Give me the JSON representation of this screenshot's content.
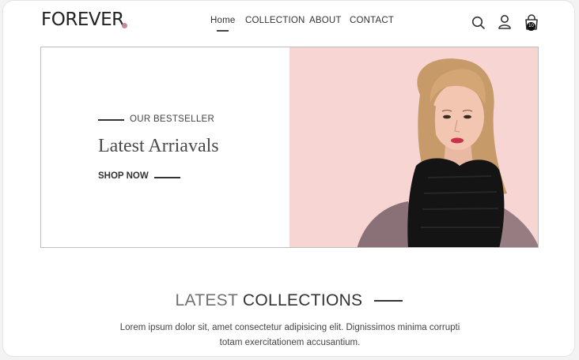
{
  "header": {
    "logo_text": "FOREVER",
    "nav": [
      {
        "label": "Home",
        "active": true
      },
      {
        "label": "COLLECTION"
      },
      {
        "label": "ABOUT"
      },
      {
        "label": "CONTACT"
      }
    ],
    "cart_count": "10"
  },
  "hero": {
    "eyebrow": "OUR BESTSELLER",
    "headline": "Latest Arriavals",
    "cta": "SHOP NOW",
    "image": "woman-in-black-scarf-photo"
  },
  "section": {
    "title_light": "LATEST",
    "title_dark": "COLLECTIONS",
    "description_line1": "Lorem ipsum dolor sit, amet consectetur adipisicing elit. Dignissimos minima corrupti",
    "description_line2": "totam exercitationem accusantium."
  },
  "colors": {
    "accent_dot": "#c586a5",
    "hero_pink": "#f7d5d3"
  },
  "icons": [
    "search-icon",
    "profile-icon",
    "shopping-bag-icon"
  ]
}
